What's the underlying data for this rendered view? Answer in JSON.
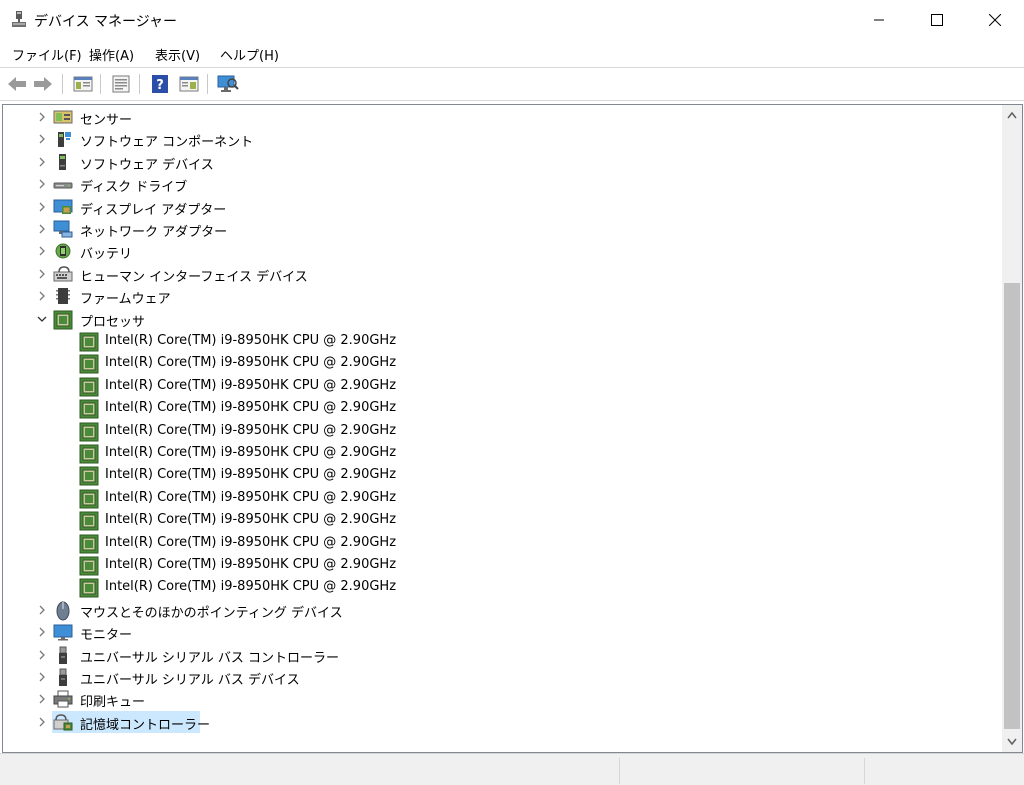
{
  "window": {
    "title": "デバイス マネージャー",
    "controls": {
      "minimize": "minimize",
      "maximize": "maximize",
      "close": "close"
    }
  },
  "menu": [
    {
      "label": "ファイル(F)"
    },
    {
      "label": "操作(A)"
    },
    {
      "label": "表示(V)"
    },
    {
      "label": "ヘルプ(H)"
    }
  ],
  "toolbar": [
    {
      "icon": "back-arrow-icon"
    },
    {
      "icon": "forward-arrow-icon"
    },
    {
      "icon": "show-hide-console-tree-icon"
    },
    {
      "icon": "properties-icon"
    },
    {
      "icon": "help-icon"
    },
    {
      "icon": "action-pane-icon"
    },
    {
      "icon": "scan-hardware-monitor-icon"
    }
  ],
  "tree": {
    "categories_before": [
      {
        "label": "センサー",
        "icon": "sensor-icon",
        "expanded": false
      },
      {
        "label": "ソフトウェア コンポーネント",
        "icon": "software-component-icon",
        "expanded": false
      },
      {
        "label": "ソフトウェア デバイス",
        "icon": "software-device-icon",
        "expanded": false
      },
      {
        "label": "ディスク ドライブ",
        "icon": "disk-drive-icon",
        "expanded": false
      },
      {
        "label": "ディスプレイ アダプター",
        "icon": "display-adapter-icon",
        "expanded": false
      },
      {
        "label": "ネットワーク アダプター",
        "icon": "network-adapter-icon",
        "expanded": false
      },
      {
        "label": "バッテリ",
        "icon": "battery-icon",
        "expanded": false
      },
      {
        "label": "ヒューマン インターフェイス デバイス",
        "icon": "hid-icon",
        "expanded": false
      },
      {
        "label": "ファームウェア",
        "icon": "firmware-icon",
        "expanded": false
      }
    ],
    "processor": {
      "label": "プロセッサ",
      "icon": "processor-icon",
      "expanded": true,
      "children": [
        "Intel(R) Core(TM) i9-8950HK CPU @ 2.90GHz",
        "Intel(R) Core(TM) i9-8950HK CPU @ 2.90GHz",
        "Intel(R) Core(TM) i9-8950HK CPU @ 2.90GHz",
        "Intel(R) Core(TM) i9-8950HK CPU @ 2.90GHz",
        "Intel(R) Core(TM) i9-8950HK CPU @ 2.90GHz",
        "Intel(R) Core(TM) i9-8950HK CPU @ 2.90GHz",
        "Intel(R) Core(TM) i9-8950HK CPU @ 2.90GHz",
        "Intel(R) Core(TM) i9-8950HK CPU @ 2.90GHz",
        "Intel(R) Core(TM) i9-8950HK CPU @ 2.90GHz",
        "Intel(R) Core(TM) i9-8950HK CPU @ 2.90GHz",
        "Intel(R) Core(TM) i9-8950HK CPU @ 2.90GHz",
        "Intel(R) Core(TM) i9-8950HK CPU @ 2.90GHz"
      ]
    },
    "categories_after": [
      {
        "label": "マウスとそのほかのポインティング デバイス",
        "icon": "mouse-icon",
        "expanded": false
      },
      {
        "label": "モニター",
        "icon": "monitor-icon",
        "expanded": false
      },
      {
        "label": "ユニバーサル シリアル バス コントローラー",
        "icon": "usb-controller-icon",
        "expanded": false
      },
      {
        "label": "ユニバーサル シリアル バス デバイス",
        "icon": "usb-device-icon",
        "expanded": false
      },
      {
        "label": "印刷キュー",
        "icon": "print-queue-icon",
        "expanded": false
      },
      {
        "label": "記憶域コントローラー",
        "icon": "storage-controller-icon",
        "expanded": false,
        "selected": true
      }
    ]
  },
  "colors": {
    "selection": "#cce8ff",
    "scroll_thumb": "#c2c2c2",
    "chip_green": "#4a8a3a"
  }
}
